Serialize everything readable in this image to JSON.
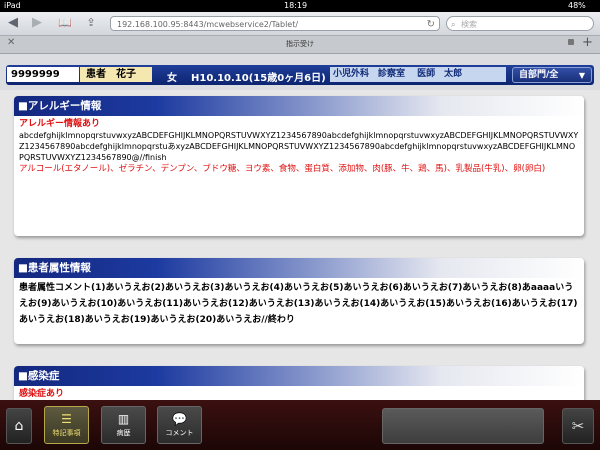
{
  "status_bar": {
    "device": "iPad",
    "time": "18:19",
    "battery": "48%"
  },
  "browser": {
    "url": "192.168.100.95:8443/mcwebservice2/Tablet/",
    "search_placeholder": "検索",
    "tab_title": "指示受け"
  },
  "patient": {
    "id": "9999999",
    "name": "患者　花子",
    "sex": "女",
    "birth": "H10.10.10(15歳0ヶ月6日)",
    "dept_line": "小児外科　診察室　 医師　太郎",
    "dept_select": "自部門/全"
  },
  "sections": [
    {
      "title": "■アレルギー情報",
      "subtitle": "アレルギー情報あり",
      "text": "abcdefghijklmnopqrstuvwxyzABCDEFGHIJKLMNOPQRSTUVWXYZ1234567890abcdefghijklmnopqrstuvwxyzABCDEFGHIJKLMNOPQRSTUVWXYZ1234567890abcdefghijklmnopqrstuあxyzABCDEFGHIJKLMNOPQRSTUVWXYZ1234567890abcdefghijklmnopqrstuvwxyzABCDEFGHIJKLMNOPQRSTUVWXYZ1234567890@//finish",
      "red_text": "アルコール(エタノール)、ゼラチン、デンプン、ブドウ糖、ヨウ素、食物、蛋白質、添加物、肉(豚、牛、鶏、馬)、乳製品(牛乳)、卵(卵白)"
    },
    {
      "title": "■患者属性情報",
      "text": "患者属性コメント(1)あいうえお(2)あいうえお(3)あいうえお(4)あいうえお(5)あいうえお(6)あいうえお(7)あいうえお(8)あaaaaいうえお(9)あいうえお(10)あいうえお(11)あいうえお(12)あいうえお(13)あいうえお(14)あいうえお(15)あいうえお(16)あいうえお(17)あいうえお(18)あいうえお(19)あいうえお(20)あいうえお//終わり"
    },
    {
      "title": "■感染症",
      "subtitle": "感染症あり"
    }
  ],
  "bottom_nav": {
    "special_notes": "特記事項",
    "history": "病歴",
    "comment": "コメント"
  },
  "icons": {
    "back": "back-arrow-icon",
    "forward": "forward-arrow-icon",
    "bookmarks": "book-icon",
    "share": "share-icon",
    "reload": "reload-icon",
    "search": "search-icon",
    "home": "home-icon",
    "tools": "tools-icon"
  },
  "colors": {
    "header_blue": "#1f3f9a",
    "accent_red": "#e01010",
    "name_bg": "#f4e7b0",
    "active_gold": "#f0e070"
  }
}
